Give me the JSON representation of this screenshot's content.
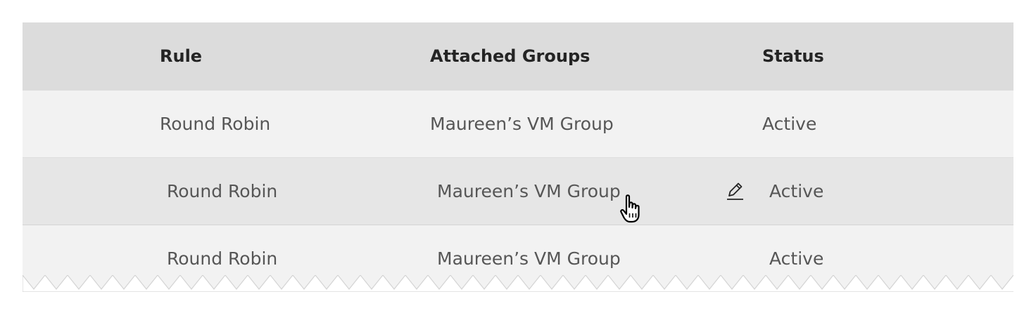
{
  "table": {
    "headers": {
      "rule": "Rule",
      "groups": "Attached Groups",
      "status": "Status"
    },
    "rows": [
      {
        "rule": "Round Robin",
        "groups": "Maureen’s VM Group",
        "status": "Active"
      },
      {
        "rule": "Round Robin",
        "groups": "Maureen’s VM Group",
        "status": "Active"
      },
      {
        "rule": "Round Robin",
        "groups": "Maureen’s VM Group",
        "status": "Active"
      }
    ]
  },
  "icons": {
    "edit": "pencil-icon",
    "cursor": "hand-pointer-cursor-icon"
  },
  "colors": {
    "header_bg": "#dcdcdc",
    "row_bg": "#f2f2f2",
    "row_hover_bg": "#e6e6e6",
    "header_text": "#242424",
    "cell_text": "#565656"
  }
}
